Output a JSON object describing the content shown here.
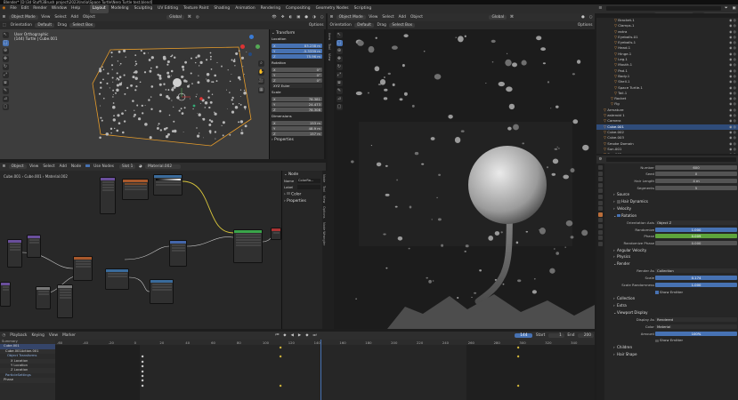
{
  "titlebar": {
    "text": "Blender* [D:\\3d Stuff\\3Brush project\\2023\\India\\Space Turtle\\Nero Turtle test.blend]"
  },
  "menubar": {
    "menus": [
      "File",
      "Edit",
      "Render",
      "Window",
      "Help"
    ],
    "workspaces": [
      "Layout",
      "Modeling",
      "Sculpting",
      "UV Editing",
      "Texture Paint",
      "Shading",
      "Animation",
      "Rendering",
      "Compositing",
      "Geometry Nodes",
      "Scripting"
    ],
    "active_workspace": "Layout",
    "scene": "Scene",
    "view_layer": "ViewLayer"
  },
  "viewport_left": {
    "mode": "Object Mode",
    "menus": [
      "View",
      "Select",
      "Add",
      "Object"
    ],
    "transform_orientation": "Global",
    "orientation_label": "Orientation",
    "orientation_value": "Default",
    "drag_label": "Drag",
    "drag_value": "Select Box",
    "options": "Options",
    "info_line1": "User Orthographic",
    "info_line2": "(144) Turtle | Cube.001",
    "npanel": {
      "transform": "Transform",
      "location": "Location",
      "loc": [
        {
          "axis": "X",
          "value": "83.238 m"
        },
        {
          "axis": "Y",
          "value": "-5.3339 m"
        },
        {
          "axis": "Z",
          "value": "75.96 m"
        }
      ],
      "rotation": "Rotation",
      "rot": [
        {
          "axis": "X",
          "value": "0°"
        },
        {
          "axis": "Y",
          "value": "0°"
        },
        {
          "axis": "Z",
          "value": "0°"
        }
      ],
      "rotation_mode": "XYZ Euler",
      "scale": "Scale",
      "scl": [
        {
          "axis": "X",
          "value": "78.381"
        },
        {
          "axis": "Y",
          "value": "24.473"
        },
        {
          "axis": "Z",
          "value": "78.308"
        }
      ],
      "dimensions": "Dimensions",
      "dim": [
        {
          "axis": "X",
          "value": "153 m"
        },
        {
          "axis": "Y",
          "value": "48.9 m"
        },
        {
          "axis": "Z",
          "value": "157 m"
        }
      ],
      "properties": "Properties"
    }
  },
  "node_editor": {
    "type": "Object",
    "menus": [
      "View",
      "Select",
      "Add",
      "Node"
    ],
    "use_nodes": "Use Nodes",
    "slot": "Slot 1",
    "material": "Material.002",
    "crumbs": [
      "Cube.001",
      "Cube.001",
      "Material.002"
    ],
    "sidebar": {
      "node_header": "Node",
      "name_label": "Name",
      "name_value": "ColorRa...",
      "label_label": "Label",
      "color": "Color",
      "properties": "Properties"
    },
    "side_tabs": [
      "Node",
      "Tool",
      "View",
      "Options",
      "Node Wrangler"
    ]
  },
  "viewport_right": {
    "mode": "Object Mode",
    "menus": [
      "View",
      "Select",
      "Add",
      "Object"
    ],
    "transform_orientation": "Global",
    "orientation_label": "Orientation",
    "orientation_value": "Default",
    "drag_label": "Drag",
    "drag_value": "Select Box",
    "options": "Options",
    "side_tabs": [
      "Item",
      "Tool",
      "View"
    ]
  },
  "outliner": {
    "items": [
      {
        "name": "Bracket.1",
        "indent": 4,
        "selected": false
      },
      {
        "name": "Clamps.1",
        "indent": 4,
        "selected": false
      },
      {
        "name": "extra",
        "indent": 4,
        "selected": false
      },
      {
        "name": "Eyeballs.01",
        "indent": 4,
        "selected": false
      },
      {
        "name": "Eyeballs.1",
        "indent": 4,
        "selected": false
      },
      {
        "name": "Head.1",
        "indent": 4,
        "selected": false
      },
      {
        "name": "Hinge.1",
        "indent": 4,
        "selected": false
      },
      {
        "name": "Leg.1",
        "indent": 4,
        "selected": false
      },
      {
        "name": "Mouth.1",
        "indent": 4,
        "selected": false
      },
      {
        "name": "Pad.1",
        "indent": 4,
        "selected": false
      },
      {
        "name": "Body.1",
        "indent": 4,
        "selected": false
      },
      {
        "name": "Shell.1",
        "indent": 4,
        "selected": false
      },
      {
        "name": "Space Turtle.1",
        "indent": 4,
        "selected": false
      },
      {
        "name": "Tail.1",
        "indent": 4,
        "selected": false
      },
      {
        "name": "Rocket",
        "indent": 3,
        "selected": false
      },
      {
        "name": "Fig",
        "indent": 3,
        "selected": false
      },
      {
        "name": "Armature",
        "indent": 1,
        "selected": false
      },
      {
        "name": "asteroid 1",
        "indent": 1,
        "selected": false
      },
      {
        "name": "Camera",
        "indent": 1,
        "selected": false
      },
      {
        "name": "Cube.001",
        "indent": 1,
        "selected": true
      },
      {
        "name": "Cube.002",
        "indent": 1,
        "selected": false
      },
      {
        "name": "Cube.003",
        "indent": 1,
        "selected": false
      },
      {
        "name": "Smoke Domain",
        "indent": 1,
        "selected": false
      },
      {
        "name": "Sun.001",
        "indent": 1,
        "selected": false
      },
      {
        "name": "Sun.002",
        "indent": 1,
        "selected": false
      }
    ]
  },
  "properties": {
    "search_placeholder": "",
    "rows_top": [
      {
        "label": "Number",
        "value": "600"
      },
      {
        "label": "Seed",
        "value": "0"
      },
      {
        "label": "Hair Length",
        "value": "4 m"
      },
      {
        "label": "Segments",
        "value": "5"
      }
    ],
    "sections_a": [
      "Source",
      "Hair Dynamics",
      "Velocity"
    ],
    "rotation_section": "Rotation",
    "rotation_rows": [
      {
        "label": "Orientation Axis",
        "value": "Object Z",
        "style": "drop"
      },
      {
        "label": "Randomize",
        "value": "1.000",
        "style": "blue"
      },
      {
        "label": "Phase",
        "value": "0.009",
        "style": "green"
      },
      {
        "label": "Randomize Phase",
        "value": "0.000",
        "style": "plain"
      }
    ],
    "sections_b": [
      "Angular Velocity",
      "Physics"
    ],
    "render_section": "Render",
    "render_rows": [
      {
        "label": "Render As",
        "value": "Collection",
        "style": "drop"
      },
      {
        "label": "Scale",
        "value": "0.174",
        "style": "blue"
      },
      {
        "label": "Scale Randomness",
        "value": "1.000",
        "style": "blue"
      }
    ],
    "show_emitter": "Show Emitter",
    "sections_c": [
      "Collection",
      "Extra"
    ],
    "viewport_display_section": "Viewport Display",
    "vd_rows": [
      {
        "label": "Display As",
        "value": "Rendered",
        "style": "drop"
      },
      {
        "label": "Color",
        "value": "Material",
        "style": "drop"
      },
      {
        "label": "Amount",
        "value": "100%",
        "style": "blue"
      }
    ],
    "show_emitter2": "Show Emitter",
    "sections_d": [
      "Children",
      "Hair Shape"
    ]
  },
  "timeline": {
    "menus": [
      "Playback",
      "Keying",
      "View",
      "Marker"
    ],
    "current_frame": "144",
    "start_label": "Start",
    "start": "1",
    "end_label": "End",
    "end": "200",
    "ruler": [
      "-60",
      "-40",
      "-20",
      "0",
      "20",
      "40",
      "60",
      "80",
      "100",
      "120",
      "140",
      "160",
      "180",
      "200",
      "220",
      "240",
      "260",
      "280",
      "300",
      "320",
      "340"
    ],
    "channels": [
      "Summary",
      "Cube.001",
      "Cube.001Action.001",
      "Object Transforms",
      "X Location",
      "Y Location",
      "Z Location",
      "ParticleSettings",
      "Phase"
    ]
  }
}
